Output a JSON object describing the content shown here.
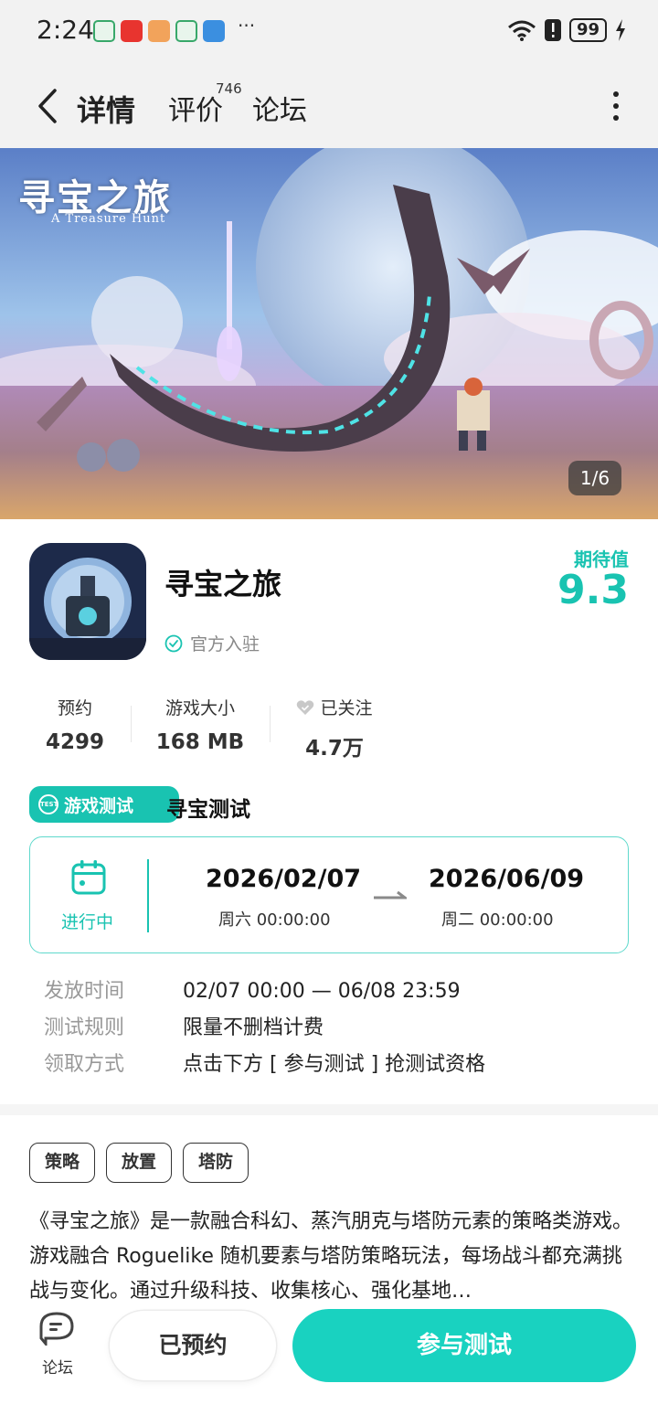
{
  "status_bar": {
    "time": "2:24",
    "more": "···",
    "battery": "99"
  },
  "nav": {
    "tabs": [
      {
        "label": "详情",
        "active": true
      },
      {
        "label": "评价",
        "count": "746"
      },
      {
        "label": "论坛"
      }
    ]
  },
  "banner": {
    "title": "寻宝之旅",
    "subtitle": "A Treasure Hunt",
    "counter": "1/6"
  },
  "app": {
    "name": "寻宝之旅",
    "official_label": "官方入驻",
    "expect_label": "期待值",
    "expect_score": "9.3"
  },
  "stats": [
    {
      "label": "预约",
      "value": "4299"
    },
    {
      "label": "游戏大小",
      "value": "168 MB"
    },
    {
      "label": "已关注",
      "value": "4.7万"
    }
  ],
  "test": {
    "badge": "游戏测试",
    "badge_icon_text": "TEST",
    "name": "寻宝测试",
    "status": "进行中",
    "start_date": "2026/02/07",
    "start_sub": "周六  00:00:00",
    "end_date": "2026/06/09",
    "end_sub": "周二  00:00:00"
  },
  "info": [
    {
      "key": "发放时间",
      "value": "02/07 00:00 — 06/08 23:59"
    },
    {
      "key": "测试规则",
      "value": "限量不删档计费"
    },
    {
      "key": "领取方式",
      "value": "点击下方 [ 参与测试 ] 抢测试资格"
    }
  ],
  "tags": [
    "策略",
    "放置",
    "塔防"
  ],
  "description": "《寻宝之旅》是一款融合科幻、蒸汽朋克与塔防元素的策略类游戏。游戏融合 Roguelike 随机要素与塔防策略玩法，每场战斗都充满挑战与变化。通过升级科技、收集核心、强化基地…",
  "bottom": {
    "forum_label": "论坛",
    "reserved_label": "已预约",
    "join_label": "参与测试"
  },
  "colors": {
    "accent": "#19c3b1",
    "button": "#19d2c0"
  }
}
